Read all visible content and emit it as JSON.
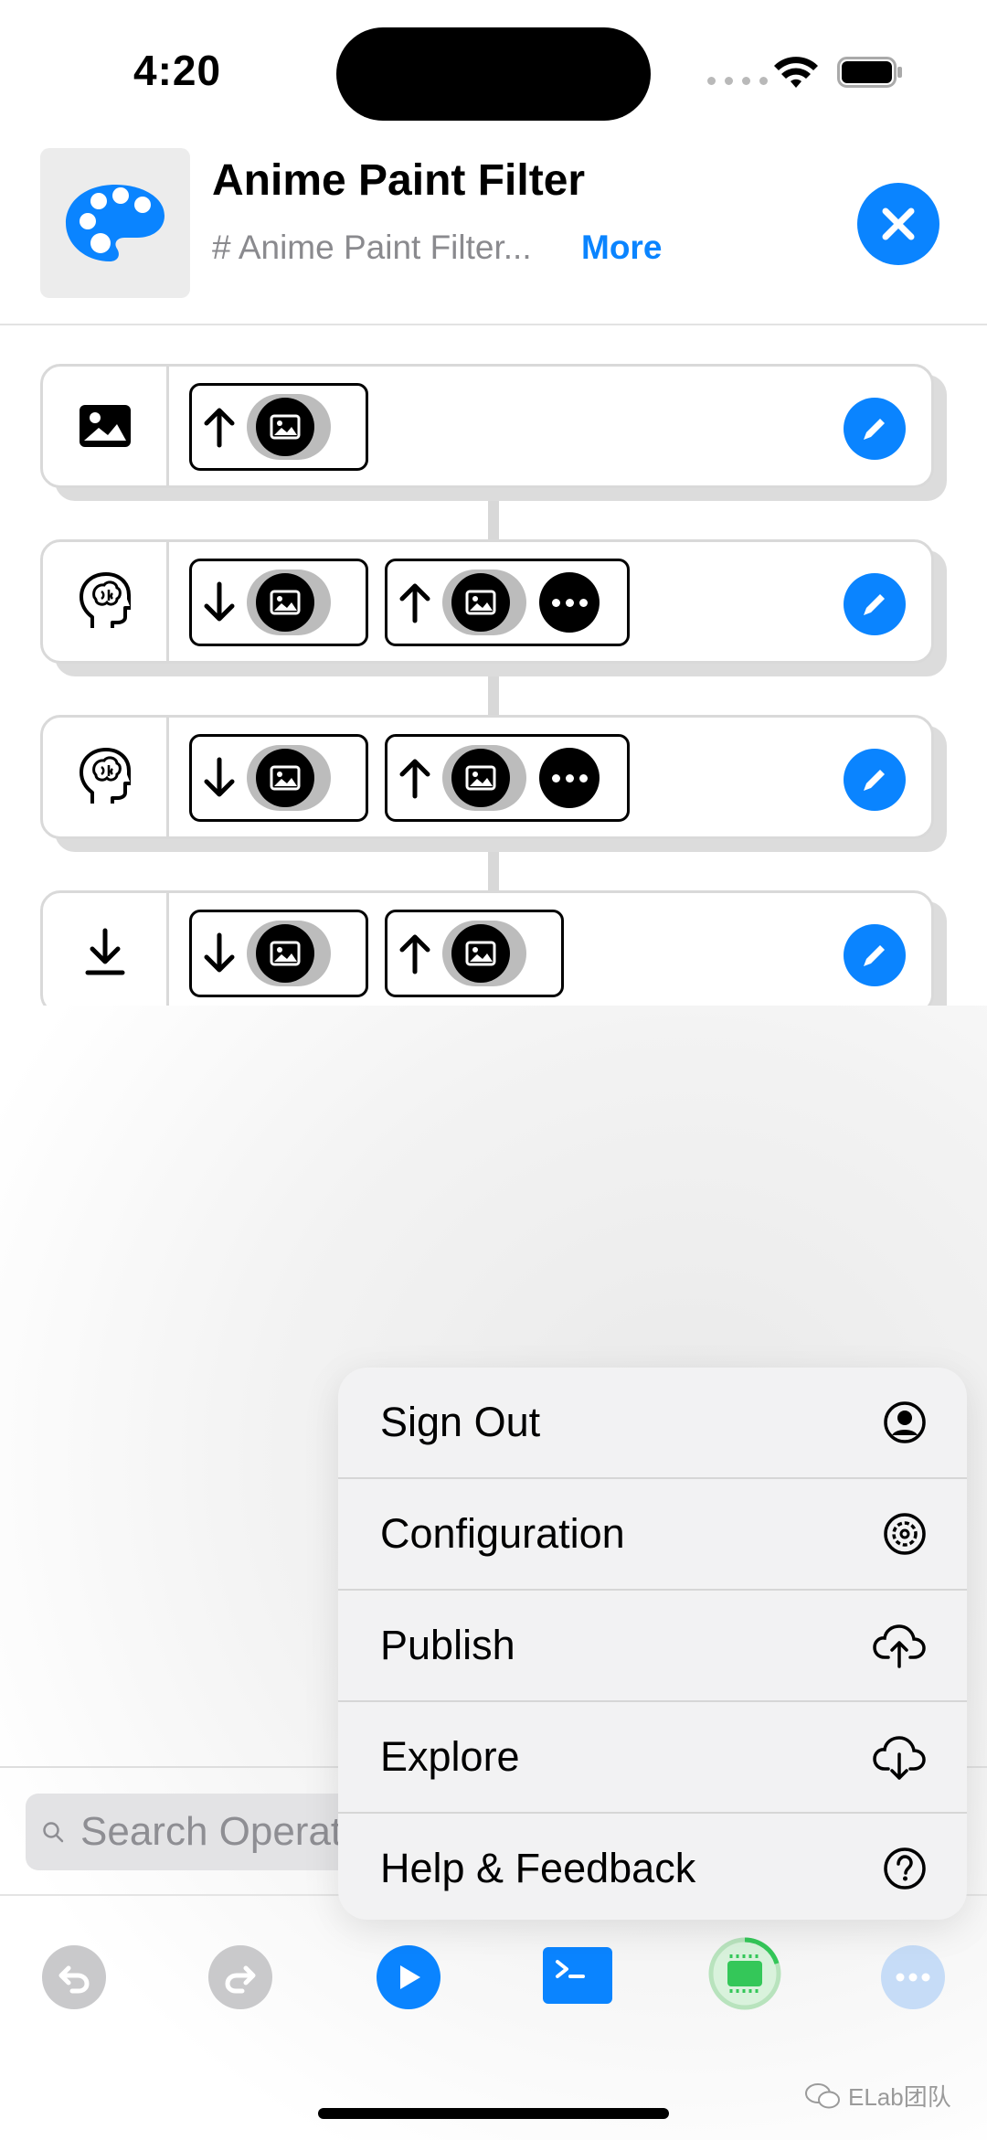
{
  "status_bar": {
    "time": "4:20"
  },
  "header": {
    "title": "Anime Paint Filter",
    "subtitle": "# Anime Paint Filter...",
    "more_label": "More",
    "accent": "#0a84ff"
  },
  "flow": {
    "nodes": [
      {
        "icon": "photo-icon",
        "ports": [
          "output-image"
        ]
      },
      {
        "icon": "brain-head-icon",
        "ports": [
          "input-image",
          "output-image-more"
        ]
      },
      {
        "icon": "brain-head-icon",
        "ports": [
          "input-image",
          "output-image-more"
        ]
      },
      {
        "icon": "download-icon",
        "ports": [
          "input-image",
          "output-image"
        ]
      }
    ]
  },
  "search": {
    "placeholder": "Search Operators"
  },
  "toolbar": {
    "items": [
      "undo-icon",
      "redo-icon",
      "play-icon",
      "terminal-icon",
      "chip-icon",
      "more-icon"
    ]
  },
  "menu": {
    "items": [
      {
        "label": "Sign Out",
        "icon": "person-circle-icon"
      },
      {
        "label": "Configuration",
        "icon": "gear-icon"
      },
      {
        "label": "Publish",
        "icon": "cloud-upload-icon"
      },
      {
        "label": "Explore",
        "icon": "cloud-download-icon"
      },
      {
        "label": "Help & Feedback",
        "icon": "question-circle-icon"
      }
    ]
  },
  "watermark": "ELab团队"
}
